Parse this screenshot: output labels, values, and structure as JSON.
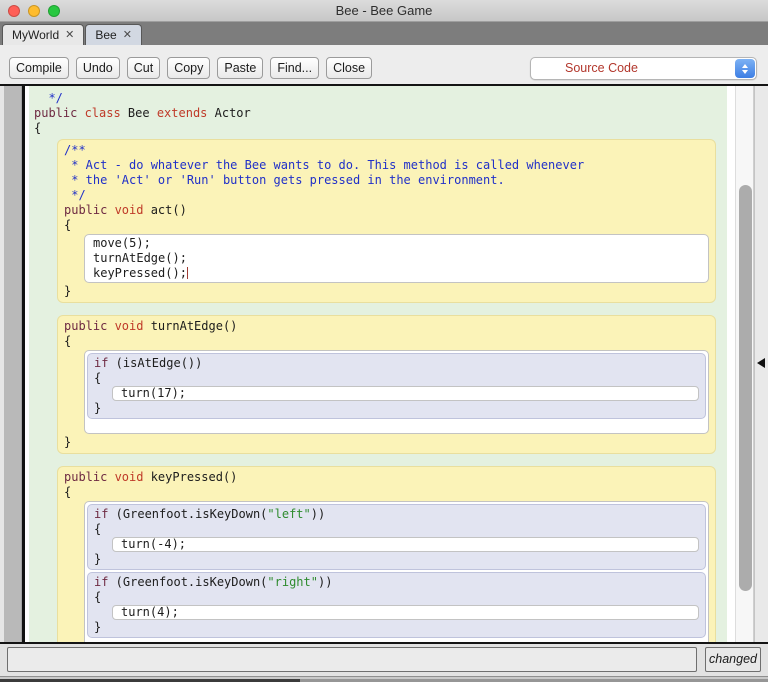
{
  "window": {
    "title": "Bee - Bee Game"
  },
  "tabs": {
    "close_glyph": "✕",
    "items": [
      {
        "label": "MyWorld"
      },
      {
        "label": "Bee"
      }
    ]
  },
  "toolbar": {
    "buttons": {
      "compile": "Compile",
      "undo": "Undo",
      "cut": "Cut",
      "copy": "Copy",
      "paste": "Paste",
      "find": "Find...",
      "close": "Close"
    },
    "view_selector": {
      "value": "Source Code"
    }
  },
  "status": {
    "message": "",
    "changed_label": "changed"
  },
  "editor": {
    "colors": {
      "plain": "#1c1c1c",
      "comment": "#2030c8",
      "kw1": "#6e2a42",
      "kw2": "#bf3a28",
      "str": "#2e8b2e"
    },
    "class_top": [
      [
        {
          "t": "  */",
          "c": "comment"
        }
      ],
      [
        {
          "t": "public ",
          "c": "kw1"
        },
        {
          "t": "class",
          "c": "kw2"
        },
        {
          "t": " Bee ",
          "c": "plain"
        },
        {
          "t": "extends",
          "c": "kw2"
        },
        {
          "t": " Actor",
          "c": "plain"
        }
      ],
      [
        {
          "t": "{",
          "c": "plain"
        }
      ]
    ],
    "class_bottom": [
      [
        {
          "t": "}",
          "c": "plain"
        }
      ]
    ],
    "act": {
      "header": [
        [
          {
            "t": "/**",
            "c": "comment"
          }
        ],
        [
          {
            "t": " * Act - do whatever the Bee wants to do. This method is called whenever",
            "c": "comment"
          }
        ],
        [
          {
            "t": " * the 'Act' or 'Run' button gets pressed in the environment.",
            "c": "comment"
          }
        ],
        [
          {
            "t": " */",
            "c": "comment"
          }
        ],
        [
          {
            "t": "public ",
            "c": "kw1"
          },
          {
            "t": "void",
            "c": "kw2"
          },
          {
            "t": " act()",
            "c": "plain"
          }
        ],
        [
          {
            "t": "{",
            "c": "plain"
          }
        ]
      ],
      "body": [
        [
          {
            "t": "move(5);",
            "c": "plain"
          }
        ],
        [
          {
            "t": "turnAtEdge();",
            "c": "plain"
          }
        ],
        [
          {
            "t": "keyPressed();",
            "c": "plain",
            "caret": true
          }
        ]
      ],
      "close": [
        [
          {
            "t": "}",
            "c": "plain"
          }
        ]
      ]
    },
    "turn_at_edge": {
      "header": [
        [
          {
            "t": "public ",
            "c": "kw1"
          },
          {
            "t": "void",
            "c": "kw2"
          },
          {
            "t": " turnAtEdge()",
            "c": "plain"
          }
        ],
        [
          {
            "t": "{",
            "c": "plain"
          }
        ]
      ],
      "if1": {
        "head": [
          [
            {
              "t": "if",
              "c": "kw1"
            },
            {
              "t": " (isAtEdge())",
              "c": "plain"
            }
          ],
          [
            {
              "t": "{",
              "c": "plain"
            }
          ]
        ],
        "stmt": [
          [
            {
              "t": "turn(17);",
              "c": "plain"
            }
          ]
        ],
        "close": [
          [
            {
              "t": "}",
              "c": "plain"
            }
          ]
        ]
      },
      "close": [
        [
          {
            "t": "}",
            "c": "plain"
          }
        ]
      ]
    },
    "key_pressed": {
      "header": [
        [
          {
            "t": "public ",
            "c": "kw1"
          },
          {
            "t": "void",
            "c": "kw2"
          },
          {
            "t": " keyPressed()",
            "c": "plain"
          }
        ],
        [
          {
            "t": "{",
            "c": "plain"
          }
        ]
      ],
      "if1": {
        "head": [
          [
            {
              "t": "if",
              "c": "kw1"
            },
            {
              "t": " (Greenfoot.isKeyDown(",
              "c": "plain"
            },
            {
              "t": "\"left\"",
              "c": "str"
            },
            {
              "t": "))",
              "c": "plain"
            }
          ],
          [
            {
              "t": "{",
              "c": "plain"
            }
          ]
        ],
        "stmt": [
          [
            {
              "t": "turn(-4);",
              "c": "plain"
            }
          ]
        ],
        "close": [
          [
            {
              "t": "}",
              "c": "plain"
            }
          ]
        ]
      },
      "if2": {
        "head": [
          [
            {
              "t": "if",
              "c": "kw1"
            },
            {
              "t": " (Greenfoot.isKeyDown(",
              "c": "plain"
            },
            {
              "t": "\"right\"",
              "c": "str"
            },
            {
              "t": "))",
              "c": "plain"
            }
          ],
          [
            {
              "t": "{",
              "c": "plain"
            }
          ]
        ],
        "stmt": [
          [
            {
              "t": "turn(4);",
              "c": "plain"
            }
          ]
        ],
        "close": [
          [
            {
              "t": "}",
              "c": "plain"
            }
          ]
        ]
      },
      "close": [
        [
          {
            "t": "}",
            "c": "plain"
          }
        ]
      ]
    }
  },
  "icons": {
    "traffic_red": "#ff5f57",
    "traffic_yellow": "#febc2e",
    "traffic_green": "#28c840"
  }
}
